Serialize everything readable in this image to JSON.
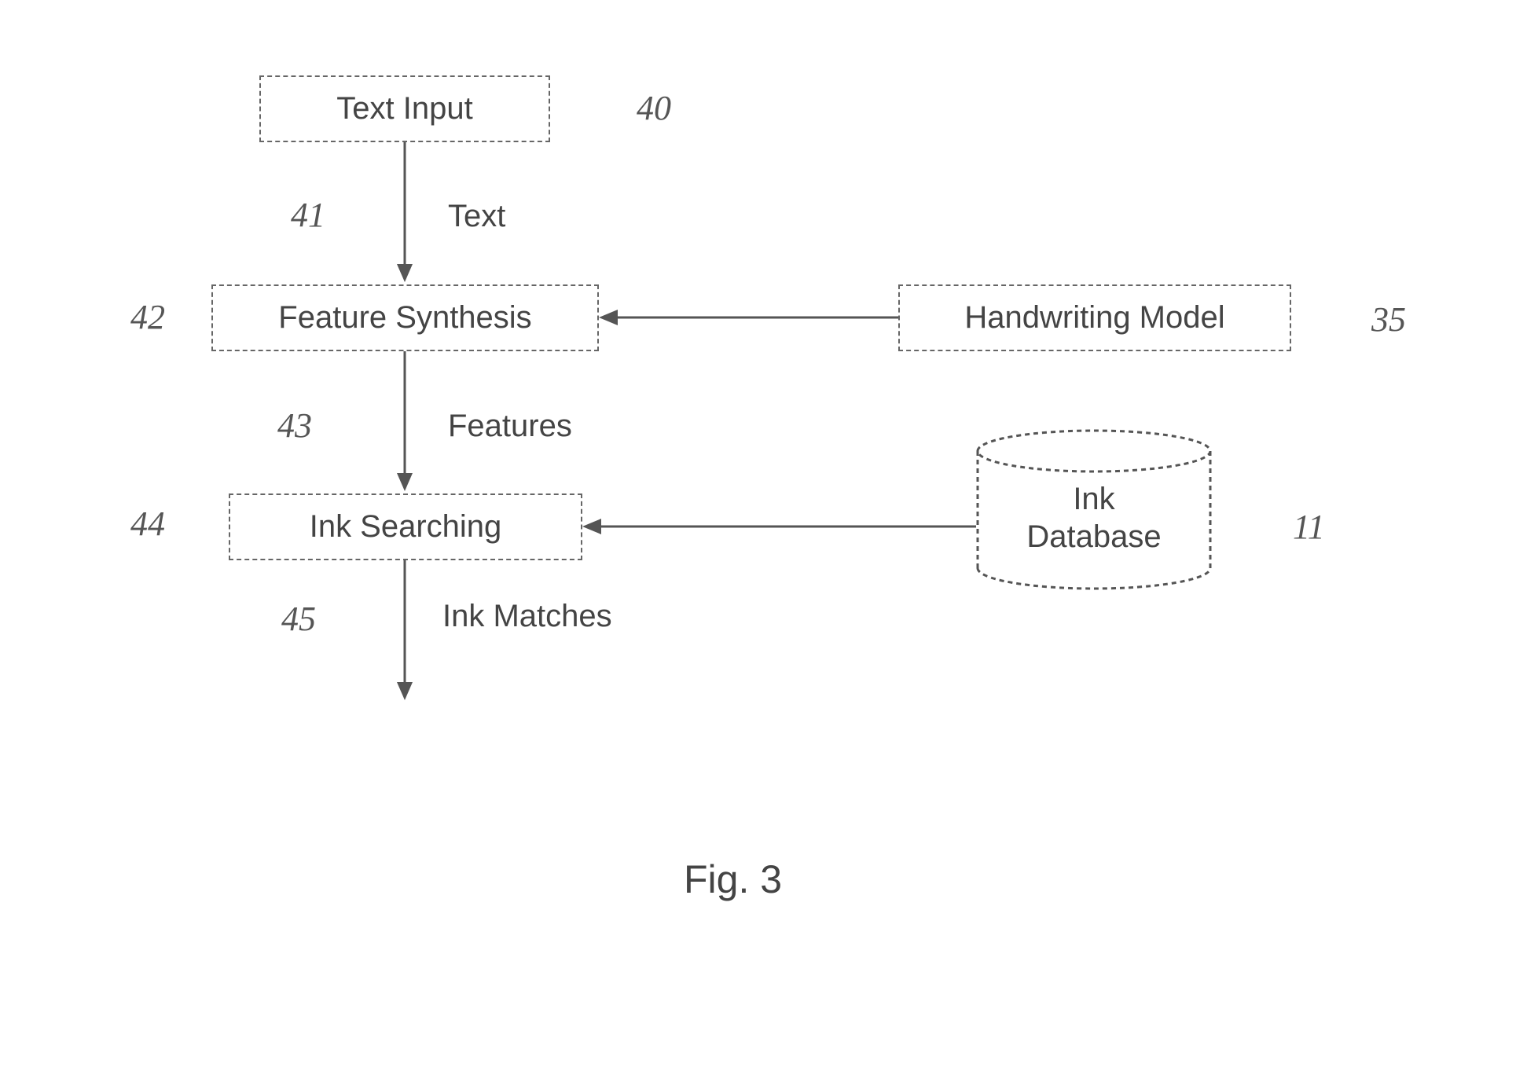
{
  "nodes": {
    "text_input": "Text Input",
    "feature_synthesis": "Feature Synthesis",
    "ink_searching": "Ink Searching",
    "handwriting_model": "Handwriting Model",
    "ink_database": "Ink\nDatabase"
  },
  "edges": {
    "text": "Text",
    "features": "Features",
    "ink_matches": "Ink Matches"
  },
  "annotations": {
    "a40": "40",
    "a41": "41",
    "a42": "42",
    "a43": "43",
    "a44": "44",
    "a45": "45",
    "a35": "35",
    "a11": "11"
  },
  "figure": "Fig. 3"
}
